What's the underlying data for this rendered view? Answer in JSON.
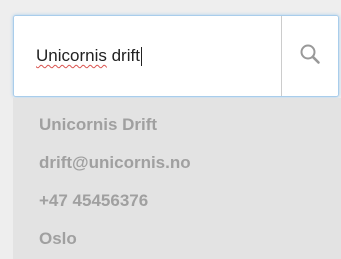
{
  "search": {
    "query_misspelled_word": "Unicornis",
    "query_rest": " drift",
    "button_icon": "search-icon"
  },
  "suggestion": {
    "name": "Unicornis Drift",
    "email": "drift@unicornis.no",
    "phone": "+47 45456376",
    "city": "Oslo"
  },
  "colors": {
    "page_background": "#eeeeee",
    "input_focus_border": "#a9cdeb",
    "dropdown_background": "#e3e3e3",
    "dropdown_text": "#a0a0a0",
    "icon_color": "#999999"
  }
}
